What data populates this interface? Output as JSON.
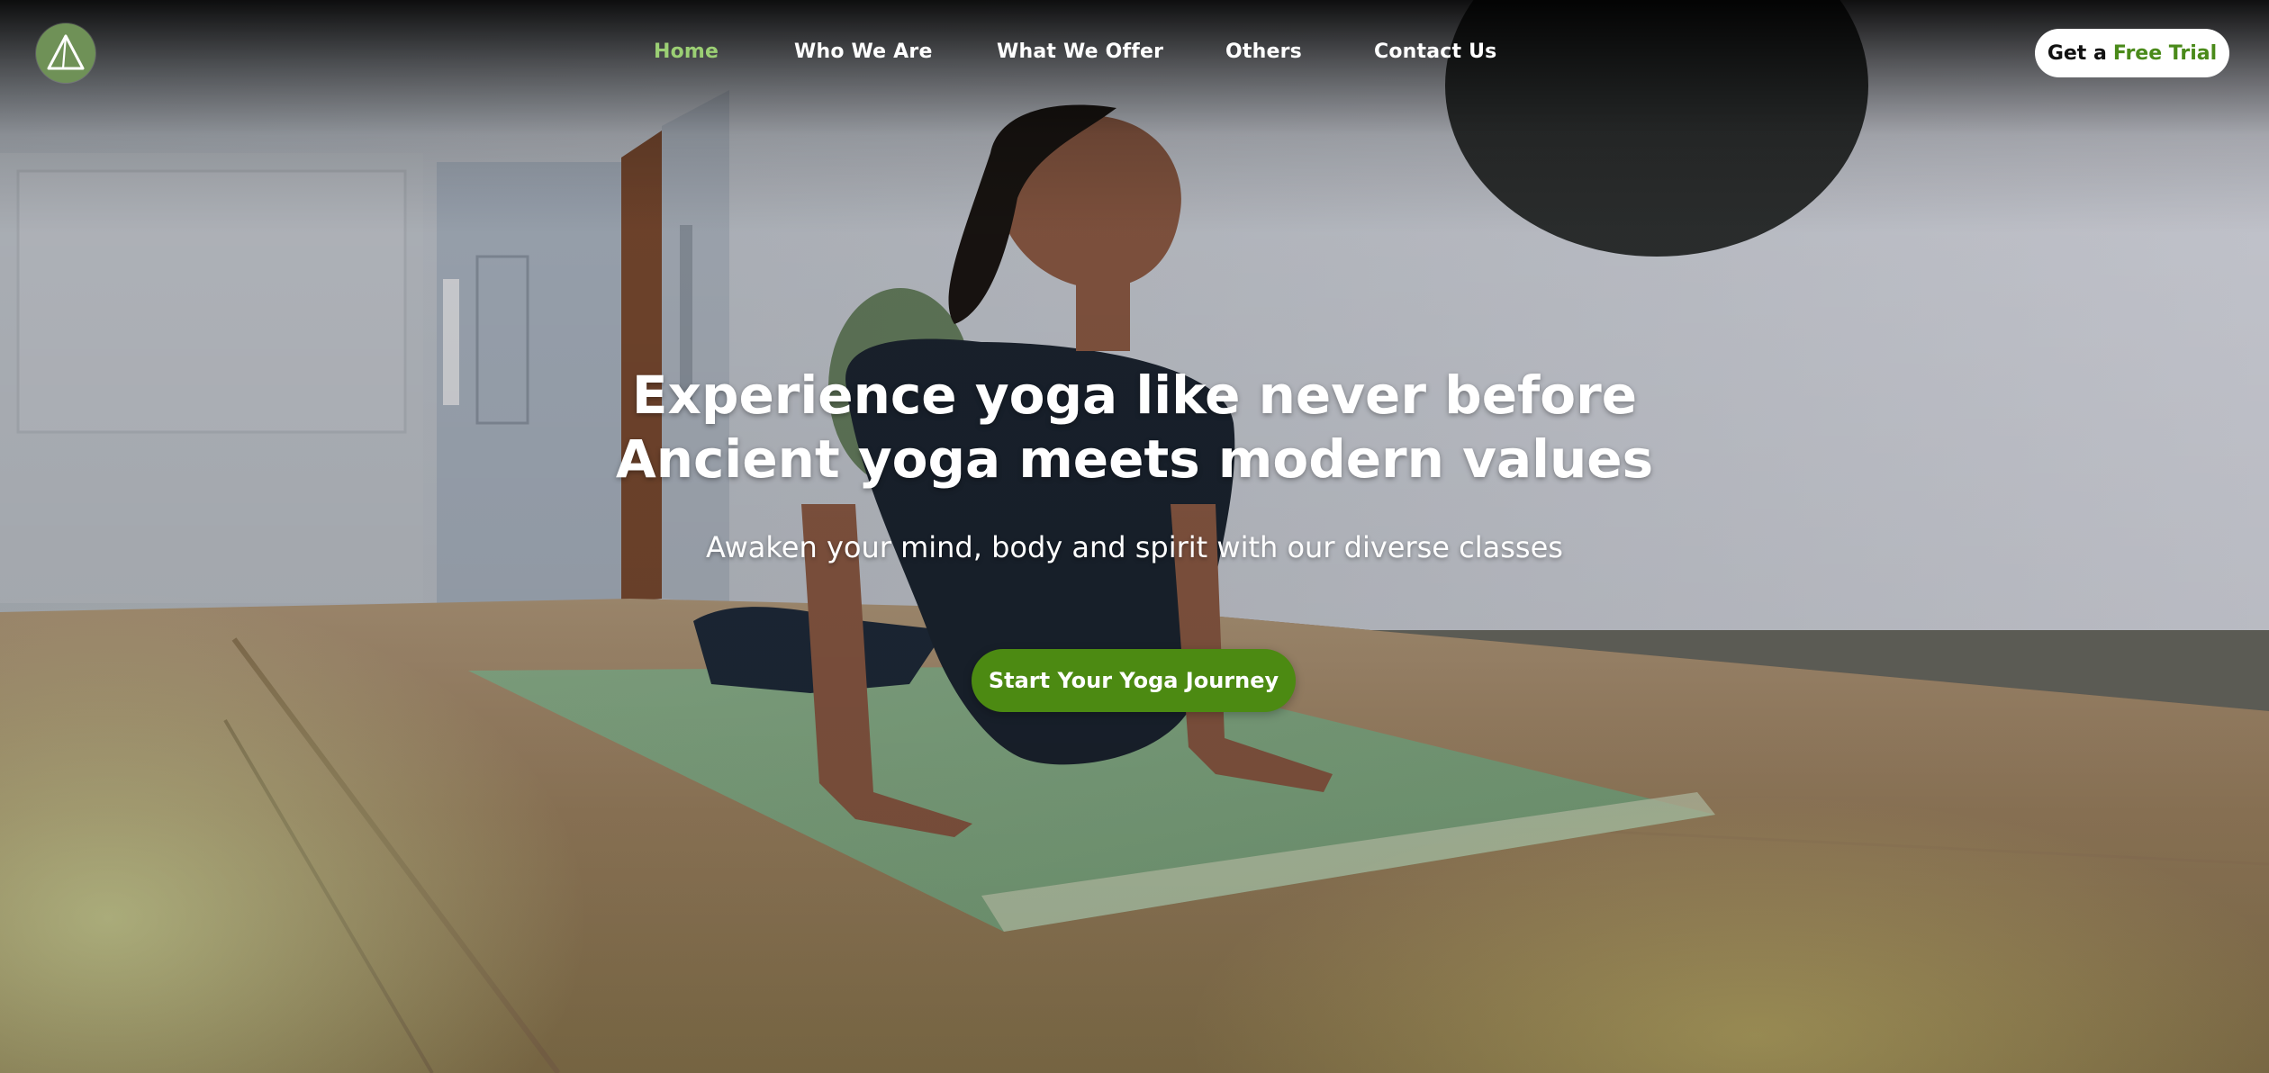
{
  "nav": {
    "items": [
      {
        "label": "Home",
        "active": true
      },
      {
        "label": "Who We Are",
        "active": false
      },
      {
        "label": "What We Offer",
        "active": false
      },
      {
        "label": "Others",
        "active": false
      },
      {
        "label": "Contact Us",
        "active": false
      }
    ],
    "trial_button": {
      "prefix": "Get a",
      "accent": "Free Trial"
    }
  },
  "hero": {
    "title_line1": "Experience yoga like never before",
    "title_line2": "Ancient yoga meets modern values",
    "subtitle": "Awaken your mind, body and spirit with our diverse classes",
    "cta_label": "Start Your Yoga Journey"
  },
  "colors": {
    "accent_green": "#4c8a12",
    "active_nav": "#9bcf74",
    "logo_bg": "#6f9157"
  },
  "icons": {
    "logo": "triangle-logo-icon"
  }
}
